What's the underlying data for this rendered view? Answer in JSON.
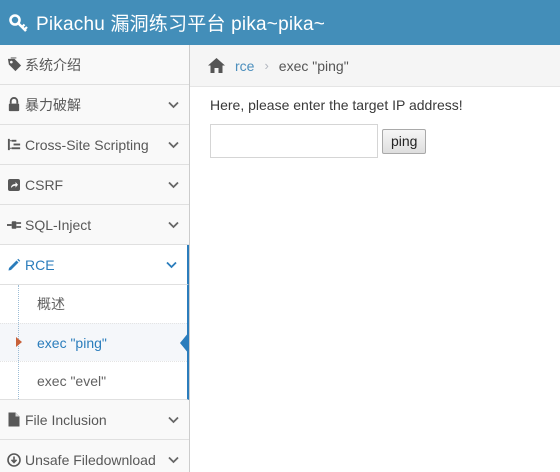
{
  "header": {
    "title": "Pikachu 漏洞练习平台 pika~pika~",
    "icon": "key-icon"
  },
  "sidebar": {
    "items": [
      {
        "label": "系统介绍",
        "icon": "tag-icon",
        "has_chevron": false
      },
      {
        "label": "暴力破解",
        "icon": "lock-icon",
        "has_chevron": true
      },
      {
        "label": "Cross-Site Scripting",
        "icon": "tree-icon",
        "has_chevron": true
      },
      {
        "label": "CSRF",
        "icon": "share-icon",
        "has_chevron": true
      },
      {
        "label": "SQL-Inject",
        "icon": "plug-icon",
        "has_chevron": true
      },
      {
        "label": "RCE",
        "icon": "pencil-icon",
        "has_chevron": true,
        "active": true
      },
      {
        "label": "File Inclusion",
        "icon": "file-icon",
        "has_chevron": true
      },
      {
        "label": "Unsafe Filedownload",
        "icon": "download-icon",
        "has_chevron": true
      }
    ],
    "rce_submenu": [
      {
        "label": "概述"
      },
      {
        "label": "exec \"ping\"",
        "active": true
      },
      {
        "label": "exec \"evel\""
      }
    ]
  },
  "breadcrumb": {
    "link": "rce",
    "current": "exec \"ping\""
  },
  "main": {
    "prompt": "Here, please enter the target IP address!",
    "ip_input": {
      "value": "",
      "placeholder": ""
    },
    "submit_label": "ping"
  },
  "colors": {
    "header": "#438eb9",
    "accent": "#2b7dbc",
    "caret": "#c86139"
  }
}
